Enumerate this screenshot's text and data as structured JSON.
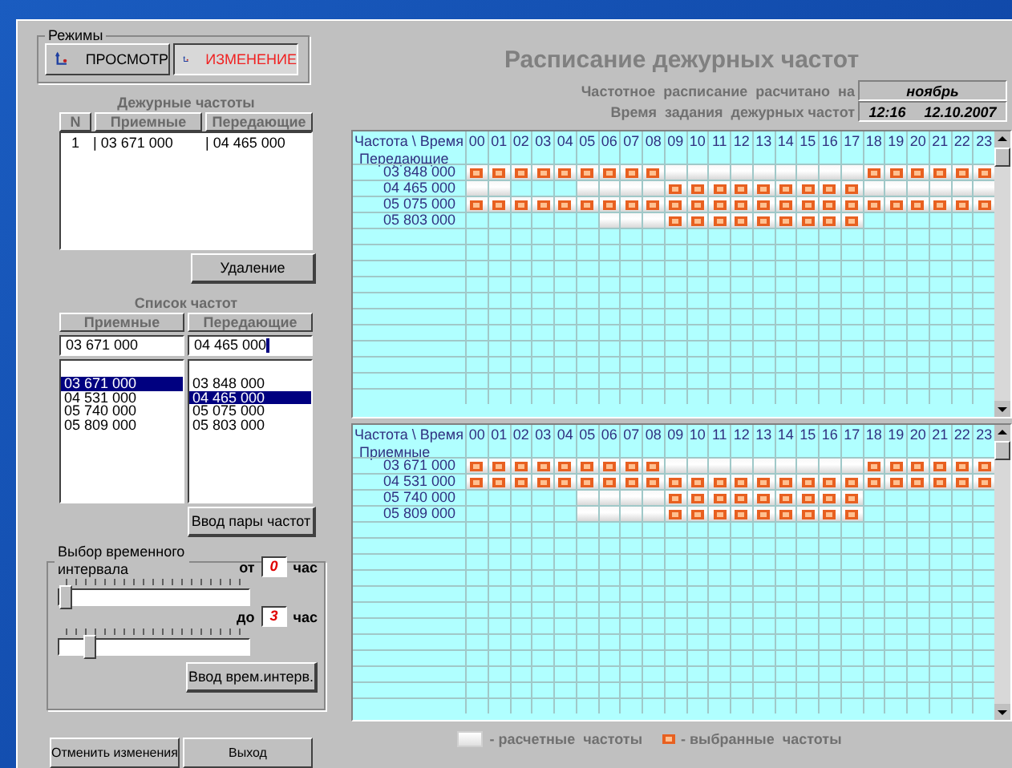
{
  "modes": {
    "title": "Режимы",
    "buttons": [
      {
        "label": "ПРОСМОТР",
        "selected": false
      },
      {
        "label": "ИЗМЕНЕНИЕ",
        "selected": true
      }
    ]
  },
  "duty": {
    "title": "Дежурные частоты",
    "columns": [
      "N",
      "Приемные",
      "Передающие"
    ],
    "rows": [
      [
        "1",
        "| 03 671 000",
        "| 04 465 000"
      ]
    ],
    "delete_button": "Удаление"
  },
  "freq_list": {
    "title": "Список частот",
    "columns": [
      "Приемные",
      "Передающие"
    ],
    "inputs": [
      {
        "value": "03 671 000"
      },
      {
        "value": "04 465 000"
      }
    ],
    "lists": [
      {
        "items": [
          {
            "label": "03 671 000",
            "selected": true
          },
          {
            "label": "04 531 000",
            "selected": false
          },
          {
            "label": "05 740 000",
            "selected": false
          },
          {
            "label": "05 809 000",
            "selected": false
          }
        ]
      },
      {
        "items": [
          {
            "label": "03 848 000",
            "selected": false
          },
          {
            "label": "04 465 000",
            "selected": true
          },
          {
            "label": "05 075 000",
            "selected": false
          },
          {
            "label": "05 803 000",
            "selected": false
          }
        ]
      }
    ],
    "button": "Ввод пары частот"
  },
  "interval": {
    "title": "Выбор временного интервала",
    "from_label": "от",
    "from_value": "0",
    "to_label": "до",
    "to_value": "3",
    "unit_from": "час",
    "unit_to": "час",
    "sliders": [
      {
        "level": 0
      },
      {
        "level": 0.13
      }
    ],
    "button": "Ввод врем.интерв."
  },
  "footer_buttons": [
    "Отменить изменения",
    "Выход"
  ],
  "schedule": {
    "title": "Расписание дежурных частот",
    "info": [
      {
        "label": "Частотное  расписание  расчитано  на",
        "values": [
          "ноябрь"
        ]
      },
      {
        "label": "Время  задания  дежурных частот",
        "values": [
          "12:16",
          "12.10.2007"
        ]
      }
    ]
  },
  "grids": [
    {
      "header": "Частота \\ Время",
      "subheader": "Передающие",
      "hours": [
        "00",
        "01",
        "02",
        "03",
        "04",
        "05",
        "06",
        "07",
        "08",
        "09",
        "10",
        "11",
        "12",
        "13",
        "14",
        "15",
        "16",
        "17",
        "18",
        "19",
        "20",
        "21",
        "22",
        "23"
      ],
      "rows": [
        {
          "freq": "03 848 000",
          "calculated": [
            true,
            true,
            true,
            true,
            true,
            true,
            true,
            true,
            true,
            true,
            true,
            true,
            true,
            true,
            true,
            true,
            true,
            true,
            true,
            true,
            true,
            true,
            true,
            true
          ],
          "selected": [
            true,
            true,
            true,
            true,
            true,
            true,
            true,
            true,
            true,
            false,
            false,
            false,
            false,
            false,
            false,
            false,
            false,
            false,
            true,
            true,
            true,
            true,
            true,
            true
          ]
        },
        {
          "freq": "04 465 000",
          "calculated": [
            true,
            true,
            false,
            false,
            false,
            true,
            true,
            true,
            true,
            true,
            true,
            true,
            true,
            true,
            true,
            true,
            true,
            true,
            true,
            true,
            true,
            true,
            true,
            true
          ],
          "selected": [
            false,
            false,
            false,
            false,
            false,
            false,
            false,
            false,
            false,
            true,
            true,
            true,
            true,
            true,
            true,
            true,
            true,
            true,
            false,
            false,
            false,
            false,
            false,
            false
          ]
        },
        {
          "freq": "05 075 000",
          "calculated": [
            true,
            true,
            true,
            true,
            true,
            true,
            true,
            true,
            true,
            true,
            true,
            true,
            true,
            true,
            true,
            true,
            true,
            true,
            true,
            true,
            true,
            true,
            true,
            true
          ],
          "selected": [
            true,
            true,
            true,
            true,
            true,
            true,
            true,
            true,
            true,
            true,
            true,
            true,
            true,
            true,
            true,
            true,
            true,
            true,
            true,
            true,
            true,
            true,
            true,
            true
          ]
        },
        {
          "freq": "05 803 000",
          "calculated": [
            false,
            false,
            false,
            false,
            false,
            false,
            true,
            true,
            true,
            true,
            true,
            true,
            true,
            true,
            true,
            true,
            true,
            true,
            false,
            false,
            false,
            false,
            false,
            false
          ],
          "selected": [
            false,
            false,
            false,
            false,
            false,
            false,
            false,
            false,
            false,
            true,
            true,
            true,
            true,
            true,
            true,
            true,
            true,
            true,
            false,
            false,
            false,
            false,
            false,
            false
          ]
        }
      ]
    },
    {
      "header": "Частота \\ Время",
      "subheader": "Приемные",
      "hours": [
        "00",
        "01",
        "02",
        "03",
        "04",
        "05",
        "06",
        "07",
        "08",
        "09",
        "10",
        "11",
        "12",
        "13",
        "14",
        "15",
        "16",
        "17",
        "18",
        "19",
        "20",
        "21",
        "22",
        "23"
      ],
      "rows": [
        {
          "freq": "03 671 000",
          "calculated": [
            true,
            true,
            true,
            true,
            true,
            true,
            true,
            true,
            true,
            true,
            true,
            true,
            true,
            true,
            true,
            true,
            true,
            true,
            true,
            true,
            true,
            true,
            true,
            true
          ],
          "selected": [
            true,
            true,
            true,
            true,
            true,
            true,
            true,
            true,
            true,
            false,
            false,
            false,
            false,
            false,
            false,
            false,
            false,
            false,
            true,
            true,
            true,
            true,
            true,
            true
          ]
        },
        {
          "freq": "04 531 000",
          "calculated": [
            true,
            true,
            true,
            true,
            true,
            true,
            true,
            true,
            true,
            true,
            true,
            true,
            true,
            true,
            true,
            true,
            true,
            true,
            true,
            true,
            true,
            true,
            true,
            true
          ],
          "selected": [
            true,
            true,
            true,
            true,
            true,
            true,
            true,
            true,
            true,
            true,
            true,
            true,
            true,
            true,
            true,
            true,
            true,
            true,
            true,
            true,
            true,
            true,
            true,
            true
          ]
        },
        {
          "freq": "05 740 000",
          "calculated": [
            false,
            false,
            false,
            false,
            false,
            true,
            true,
            true,
            true,
            true,
            true,
            true,
            true,
            true,
            true,
            true,
            true,
            true,
            false,
            false,
            false,
            false,
            false,
            false
          ],
          "selected": [
            false,
            false,
            false,
            false,
            false,
            false,
            false,
            false,
            false,
            true,
            true,
            true,
            true,
            true,
            true,
            true,
            true,
            true,
            false,
            false,
            false,
            false,
            false,
            false
          ]
        },
        {
          "freq": "05 809 000",
          "calculated": [
            false,
            false,
            false,
            false,
            false,
            true,
            true,
            true,
            true,
            true,
            true,
            true,
            true,
            true,
            true,
            true,
            true,
            true,
            false,
            false,
            false,
            false,
            false,
            false
          ],
          "selected": [
            false,
            false,
            false,
            false,
            false,
            false,
            false,
            false,
            false,
            true,
            true,
            true,
            true,
            true,
            true,
            true,
            true,
            true,
            false,
            false,
            false,
            false,
            false,
            false
          ]
        }
      ]
    }
  ],
  "legend": [
    {
      "kind": "calc",
      "label": "- расчетные  частоты"
    },
    {
      "kind": "chosen",
      "label": "- выбранные  частоты"
    }
  ]
}
